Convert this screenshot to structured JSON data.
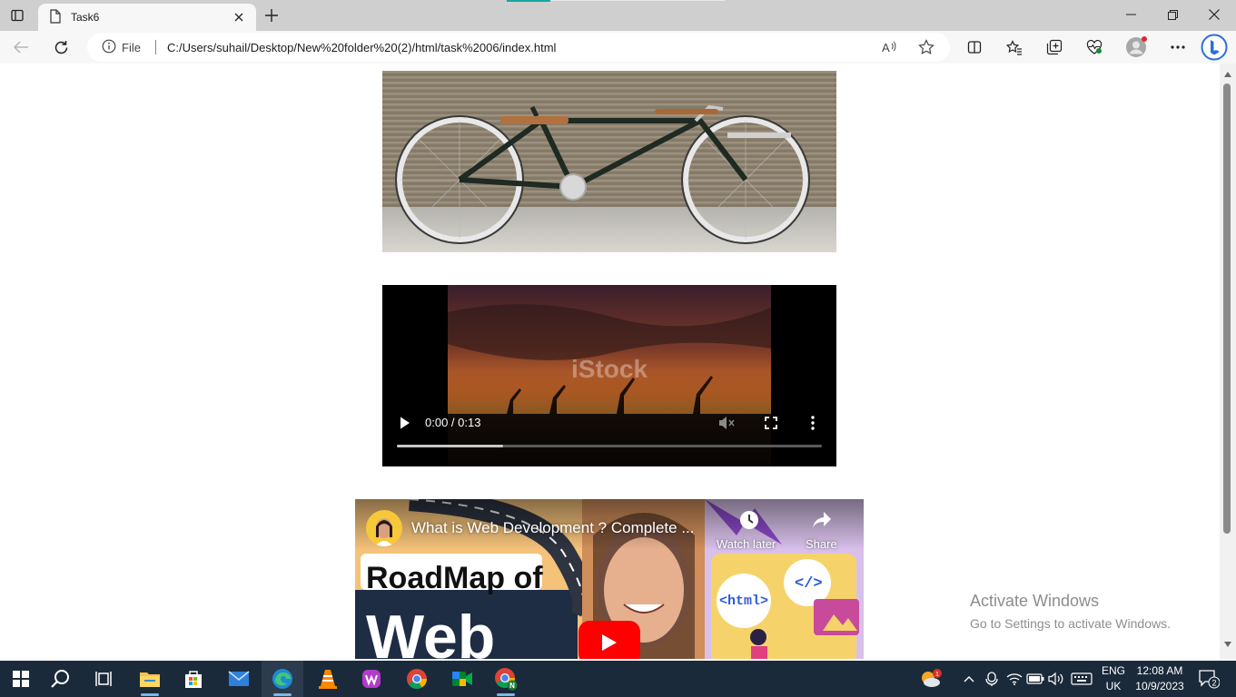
{
  "browser": {
    "tab_title": "Task6",
    "address_file_label": "File",
    "address_url": "C:/Users/suhail/Desktop/New%20folder%20(2)/html/task%2006/index.html"
  },
  "page": {
    "video": {
      "time": "0:00 / 0:13",
      "progress_fraction": 0.25,
      "watermark": "iStock"
    },
    "youtube": {
      "title": "What is Web Development ? Complete ...",
      "watch_later": "Watch later",
      "share": "Share",
      "thumb_text_1": "RoadMap of",
      "thumb_text_2": "Web",
      "html_tag": "<html>",
      "code_tag": "</>"
    }
  },
  "watermark": {
    "line1": "Activate Windows",
    "line2": "Go to Settings to activate Windows."
  },
  "taskbar": {
    "weather_badge": "1",
    "lang_1": "ENG",
    "lang_2": "UK",
    "time": "12:08 AM",
    "date": "10/9/2023",
    "notifications": "2"
  },
  "colors": {
    "taskbar": "#1b2a3a",
    "tab_accent": "#17a5a5",
    "youtube_red": "#ff0000"
  }
}
